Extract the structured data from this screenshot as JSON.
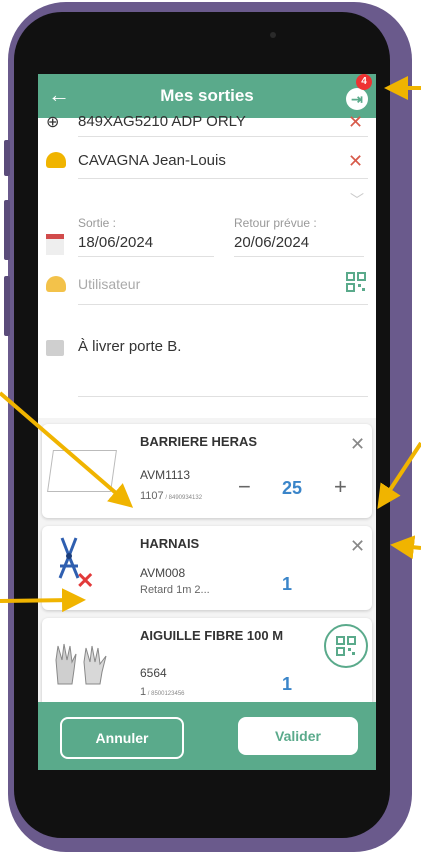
{
  "header": {
    "back_icon": "arrow-left-icon",
    "title": "Mes sorties",
    "logout_icon": "logout-icon",
    "notification_count": "4",
    "menu_icon": "kebab-menu-icon"
  },
  "form": {
    "location": "849XAG5210 ADP ORLY",
    "person": "CAVAGNA Jean-Louis",
    "sortie_label": "Sortie :",
    "sortie_value": "18/06/2024",
    "retour_label": "Retour prévue :",
    "retour_value": "20/06/2024",
    "user_placeholder": "Utilisateur",
    "note": "À livrer porte B."
  },
  "items": [
    {
      "title": "BARRIERE HERAS",
      "ref": "AVM1113",
      "sub_main": "1107",
      "sub_small": " / 8490934132",
      "qty": "25",
      "minus": "−",
      "plus": "+"
    },
    {
      "title": "HARNAIS",
      "ref": "AVM008",
      "sub_main": "Retard 1m 2...",
      "qty": "1"
    },
    {
      "title": "AIGUILLE FIBRE 100 M",
      "ref": "6564",
      "sub_main": "1",
      "sub_small": " / 8500123456",
      "qty": "1"
    }
  ],
  "footer": {
    "cancel_label": "Annuler",
    "confirm_label": "Valider"
  },
  "colors": {
    "accent": "#5aaa8b",
    "annotation": "#f0b400",
    "danger": "#d75a4a",
    "qty": "#3a85c9",
    "frame": "#6a5a8c"
  }
}
